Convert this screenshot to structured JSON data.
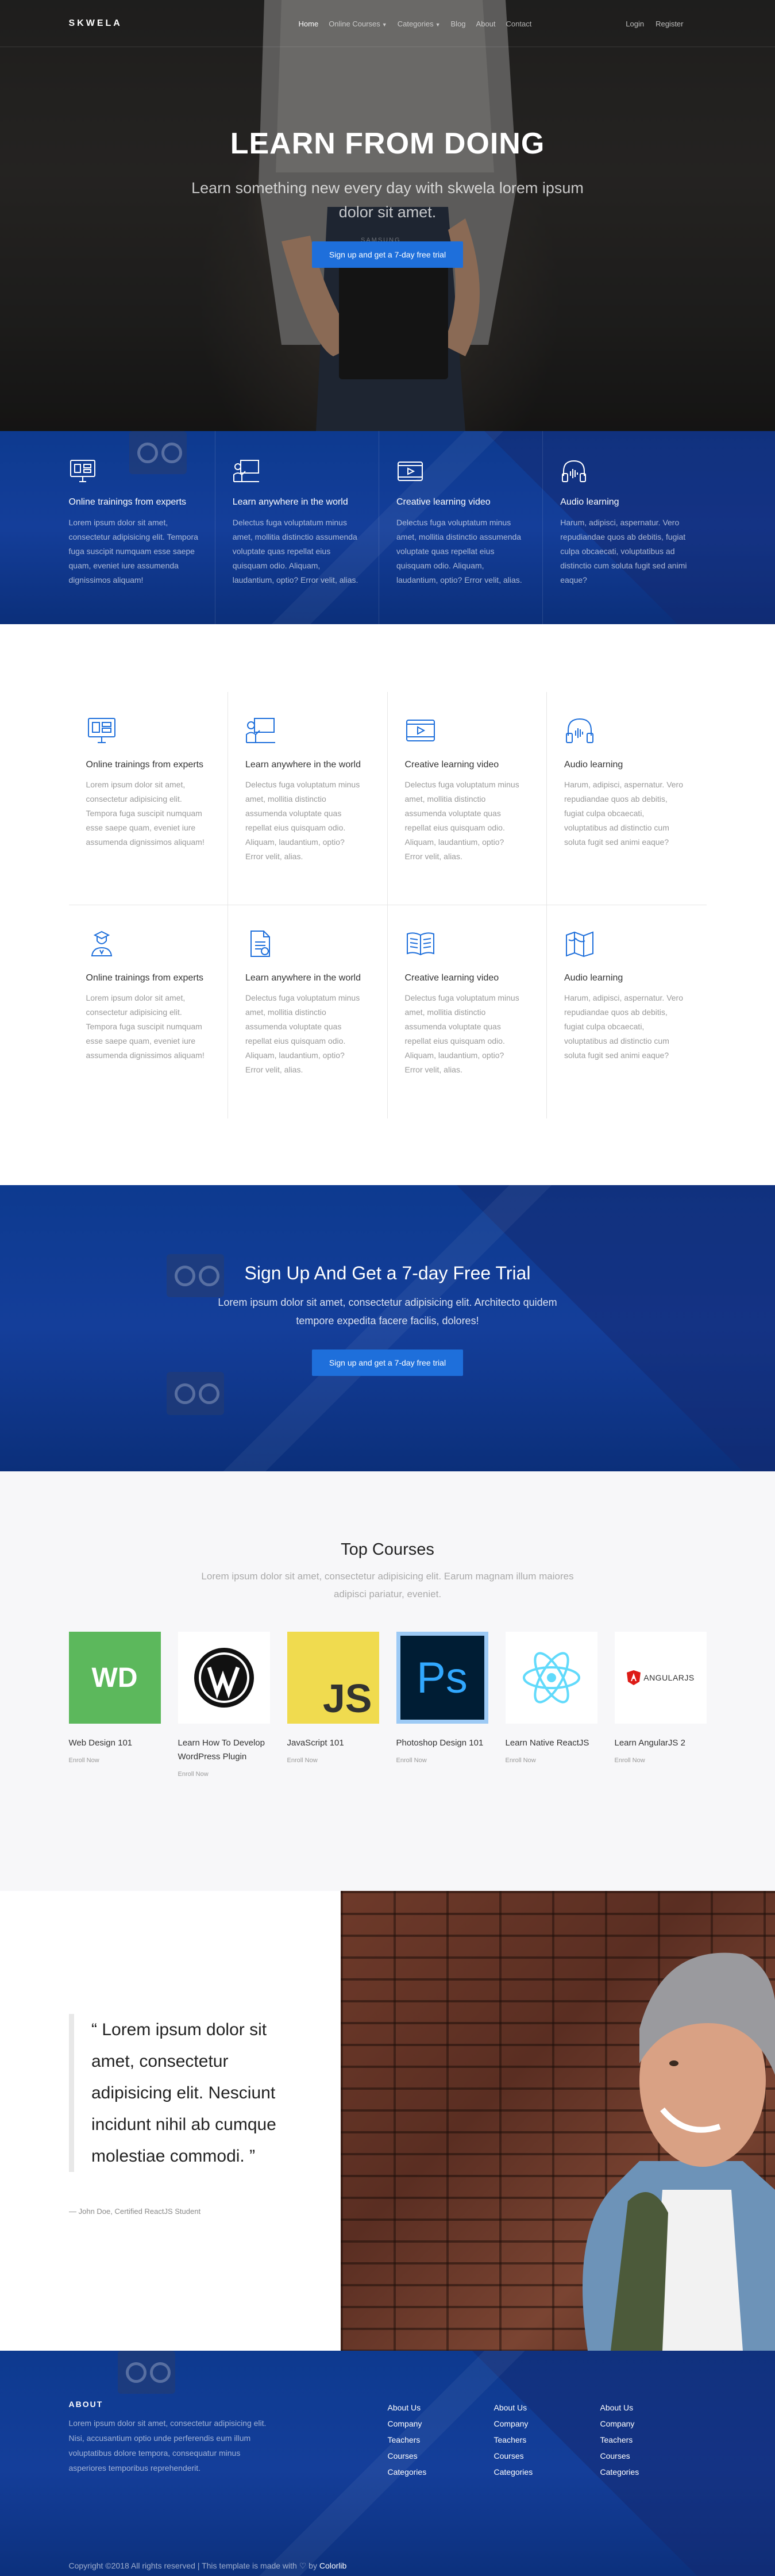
{
  "nav": {
    "logo": "SKWELA",
    "links": [
      "Home",
      "Online Courses",
      "Categories",
      "Blog",
      "About",
      "Contact"
    ],
    "auth": [
      "Login",
      "Register"
    ]
  },
  "hero": {
    "title": "LEARN FROM DOING",
    "subtitle": "Learn something new every day with skwela lorem ipsum dolor sit amet.",
    "cta": "Sign up and get a 7-day free trial",
    "bg_text": "SAMSUNG"
  },
  "features_blue": [
    {
      "icon": "monitor-screen-icon",
      "title": "Online trainings from experts",
      "text": "Lorem ipsum dolor sit amet, consectetur adipisicing elit. Tempora fuga suscipit numquam esse saepe quam, eveniet iure assumenda dignissimos aliquam!"
    },
    {
      "icon": "teacher-board-icon",
      "title": "Learn anywhere in the world",
      "text": "Delectus fuga voluptatum minus amet, mollitia distinctio assumenda voluptate quas repellat eius quisquam odio. Aliquam, laudantium, optio? Error velit, alias."
    },
    {
      "icon": "video-player-icon",
      "title": "Creative learning video",
      "text": "Delectus fuga voluptatum minus amet, mollitia distinctio assumenda voluptate quas repellat eius quisquam odio. Aliquam, laudantium, optio? Error velit, alias."
    },
    {
      "icon": "headphones-icon",
      "title": "Audio learning",
      "text": "Harum, adipisci, aspernatur. Vero repudiandae quos ab debitis, fugiat culpa obcaecati, voluptatibus ad distinctio cum soluta fugit sed animi eaque?"
    }
  ],
  "features_grid": [
    {
      "icon": "monitor-screen-icon",
      "title": "Online trainings from experts",
      "text": "Lorem ipsum dolor sit amet, consectetur adipisicing elit. Tempora fuga suscipit numquam esse saepe quam, eveniet iure assumenda dignissimos aliquam!"
    },
    {
      "icon": "teacher-board-icon",
      "title": "Learn anywhere in the world",
      "text": "Delectus fuga voluptatum minus amet, mollitia distinctio assumenda voluptate quas repellat eius quisquam odio. Aliquam, laudantium, optio? Error velit, alias."
    },
    {
      "icon": "video-player-icon",
      "title": "Creative learning video",
      "text": "Delectus fuga voluptatum minus amet, mollitia distinctio assumenda voluptate quas repellat eius quisquam odio. Aliquam, laudantium, optio? Error velit, alias."
    },
    {
      "icon": "headphones-icon",
      "title": "Audio learning",
      "text": "Harum, adipisci, aspernatur. Vero repudiandae quos ab debitis, fugiat culpa obcaecati, voluptatibus ad distinctio cum soluta fugit sed animi eaque?"
    },
    {
      "icon": "graduate-icon",
      "title": "Online trainings from experts",
      "text": "Lorem ipsum dolor sit amet, consectetur adipisicing elit. Tempora fuga suscipit numquam esse saepe quam, eveniet iure assumenda dignissimos aliquam!"
    },
    {
      "icon": "document-icon",
      "title": "Learn anywhere in the world",
      "text": "Delectus fuga voluptatum minus amet, mollitia distinctio assumenda voluptate quas repellat eius quisquam odio. Aliquam, laudantium, optio? Error velit, alias."
    },
    {
      "icon": "open-book-icon",
      "title": "Creative learning video",
      "text": "Delectus fuga voluptatum minus amet, mollitia distinctio assumenda voluptate quas repellat eius quisquam odio. Aliquam, laudantium, optio? Error velit, alias."
    },
    {
      "icon": "map-icon",
      "title": "Audio learning",
      "text": "Harum, adipisci, aspernatur. Vero repudiandae quos ab debitis, fugiat culpa obcaecati, voluptatibus ad distinctio cum soluta fugit sed animi eaque?"
    }
  ],
  "cta": {
    "title": "Sign Up And Get a 7-day Free Trial",
    "text": "Lorem ipsum dolor sit amet, consectetur adipisicing elit. Architecto quidem tempore expedita facere facilis, dolores!",
    "button": "Sign up and get a 7-day free trial"
  },
  "courses": {
    "title": "Top Courses",
    "lead": "Lorem ipsum dolor sit amet, consectetur adipisicing elit. Earum magnam illum maiores adipisci pariatur, eveniet.",
    "items": [
      {
        "logo": "WD",
        "name": "Web Design 101",
        "link": "Enroll Now"
      },
      {
        "logo": "wordpress-logo",
        "name": "Learn How To Develop WordPress Plugin",
        "link": "Enroll Now"
      },
      {
        "logo": "JS",
        "name": "JavaScript 101",
        "link": "Enroll Now"
      },
      {
        "logo": "Ps",
        "name": "Photoshop Design 101",
        "link": "Enroll Now"
      },
      {
        "logo": "react-logo",
        "name": "Learn Native ReactJS",
        "link": "Enroll Now"
      },
      {
        "logo": "ANGULARJS",
        "name": "Learn AngularJS 2",
        "link": "Enroll Now"
      }
    ]
  },
  "testimonial": {
    "quote": "“ Lorem ipsum dolor sit amet, consectetur adipisicing elit. Nesciunt incidunt nihil ab cumque molestiae commodi. ”",
    "cite": "— John Doe, Certified ReactJS Student"
  },
  "footer": {
    "about_title": "ABOUT",
    "about_text": "Lorem ipsum dolor sit amet, consectetur adipisicing elit. Nisi, accusantium optio unde perferendis eum illum voluptatibus dolore tempora, consequatur minus asperiores temporibus reprehenderit.",
    "columns": [
      [
        "About Us",
        "Company",
        "Teachers",
        "Courses",
        "Categories"
      ],
      [
        "About Us",
        "Company",
        "Teachers",
        "Courses",
        "Categories"
      ],
      [
        "About Us",
        "Company",
        "Teachers",
        "Courses",
        "Categories"
      ]
    ],
    "copyright": "Copyright ©2018 All rights reserved | This template is made with",
    "heart": "♡",
    "by": "by",
    "brand": "Colorlib"
  },
  "colors": {
    "accent": "#1e6fdb",
    "blue_bg": "#0d3a8f"
  }
}
